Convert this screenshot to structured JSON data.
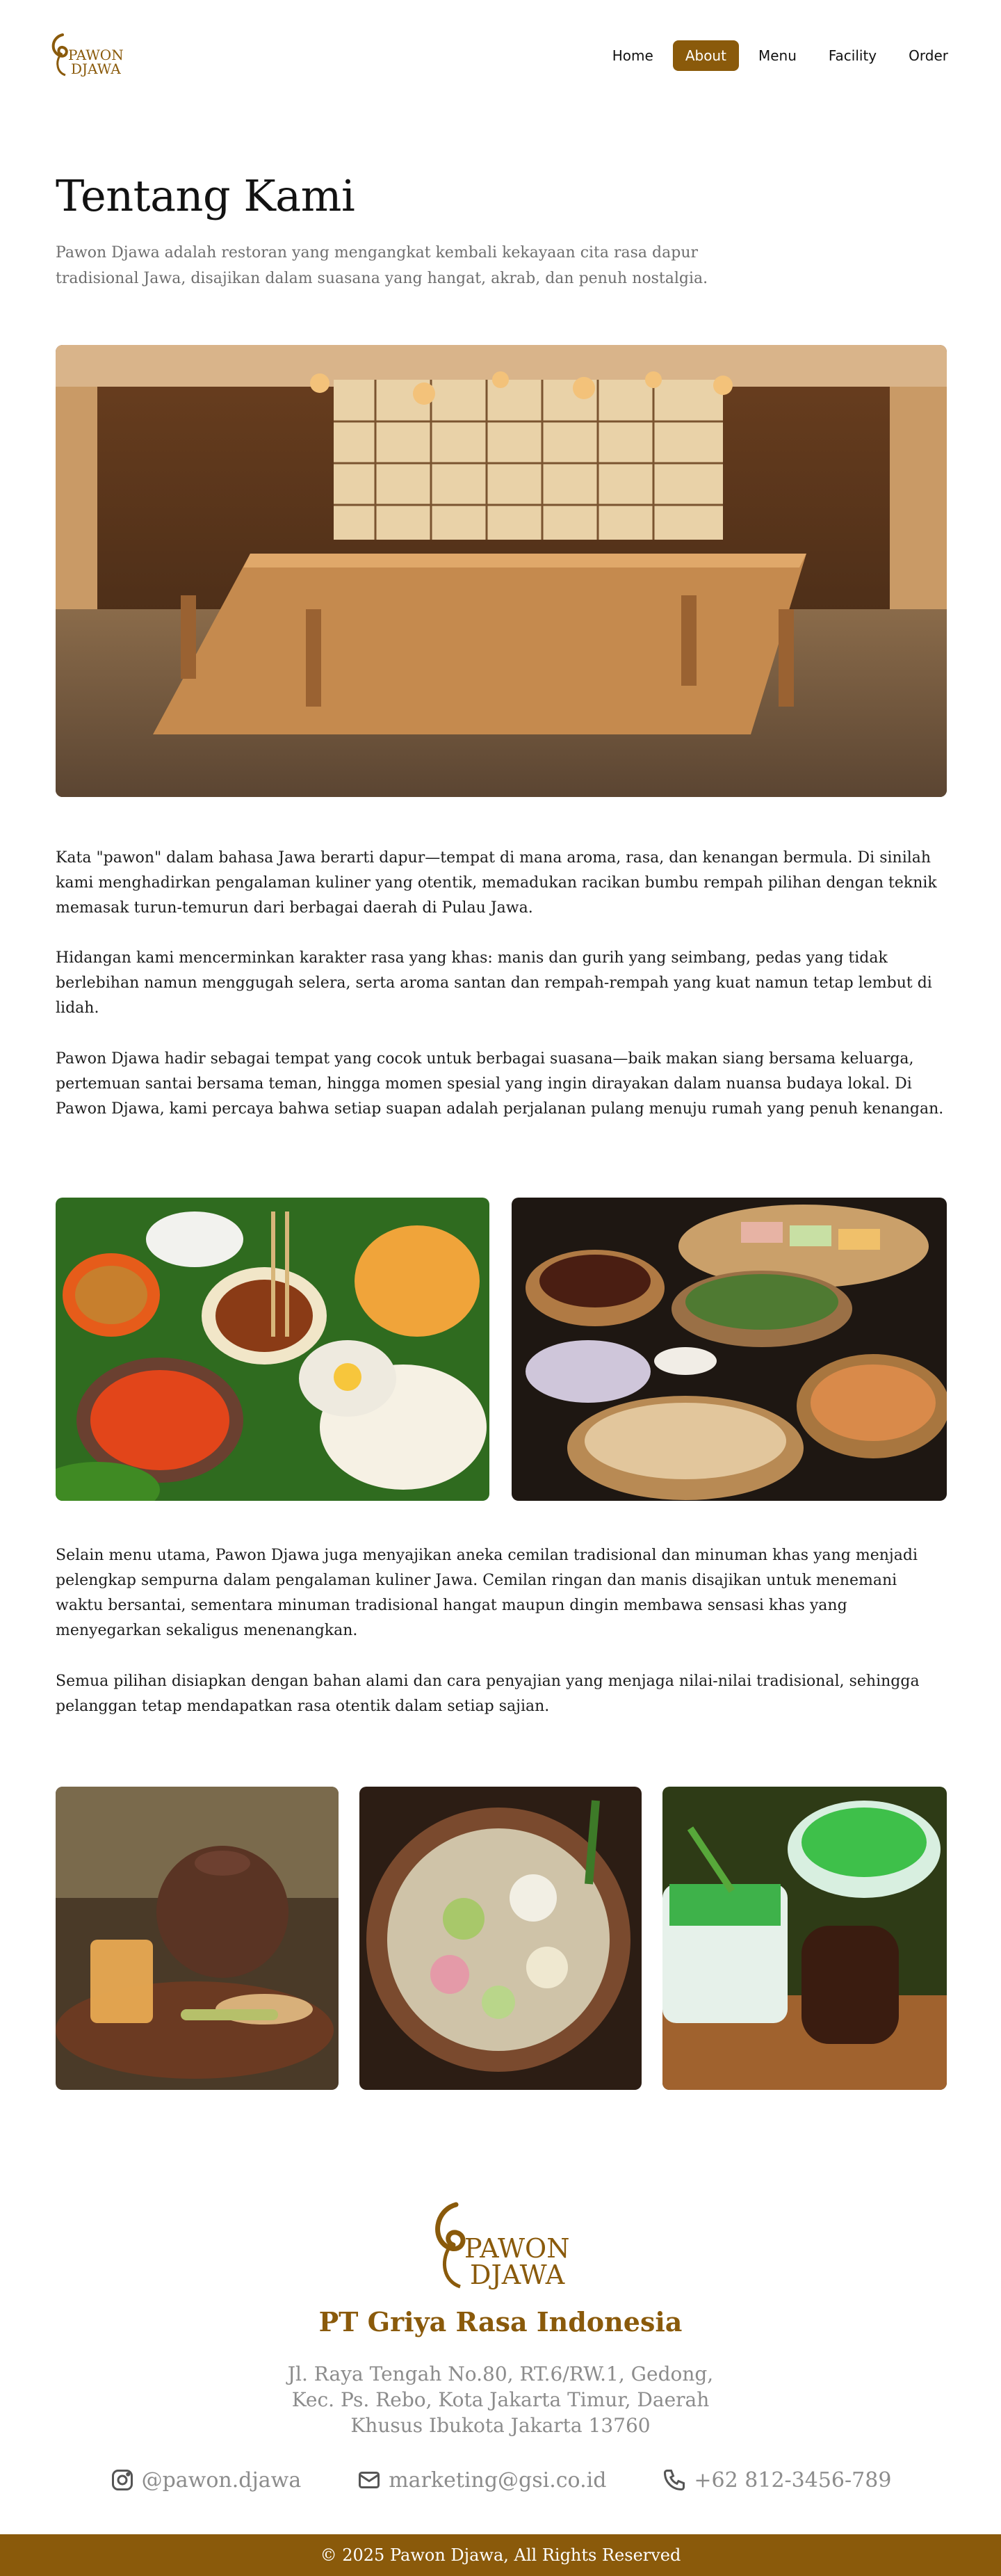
{
  "brand": {
    "logo_line1": "PAWON",
    "logo_line2": "DJAWA",
    "accent": "#8a5a0b"
  },
  "nav": {
    "items": [
      {
        "label": "Home",
        "active": false
      },
      {
        "label": "About",
        "active": true
      },
      {
        "label": "Menu",
        "active": false
      },
      {
        "label": "Facility",
        "active": false
      },
      {
        "label": "Order",
        "active": false
      }
    ]
  },
  "about": {
    "title": "Tentang Kami",
    "intro": "Pawon Djawa adalah restoran yang mengangkat kembali kekayaan cita rasa dapur tradisional Jawa, disajikan dalam suasana yang hangat, akrab, dan penuh nostalgia.",
    "paragraphs": [
      "Kata \"pawon\" dalam bahasa Jawa berarti dapur—tempat di mana aroma, rasa, dan kenangan bermula. Di sinilah kami menghadirkan pengalaman kuliner yang otentik, memadukan racikan bumbu rempah pilihan dengan teknik memasak turun-temurun dari berbagai daerah di Pulau Jawa.",
      "Hidangan kami mencerminkan karakter rasa yang khas: manis dan gurih yang seimbang, pedas yang tidak berlebihan namun menggugah selera, serta aroma santan dan rempah-rempah yang kuat namun tetap lembut di lidah.",
      "Pawon Djawa hadir sebagai tempat yang cocok untuk berbagai suasana—baik makan siang bersama keluarga, pertemuan santai bersama teman, hingga momen spesial yang ingin dirayakan dalam nuansa budaya lokal. Di Pawon Djawa, kami percaya bahwa setiap suapan adalah perjalanan pulang menuju rumah yang penuh kenangan."
    ],
    "snacks_paragraphs": [
      "Selain menu utama, Pawon Djawa juga menyajikan aneka cemilan tradisional dan minuman khas yang menjadi pelengkap sempurna dalam pengalaman kuliner Jawa. Cemilan ringan dan manis disajikan untuk menemani waktu bersantai, sementara minuman tradisional hangat maupun dingin membawa sensasi khas yang menyegarkan sekaligus menenangkan.",
      "Semua pilihan disiapkan dengan bahan alami dan cara penyajian yang menjaga nilai-nilai tradisional, sehingga pelanggan tetap mendapatkan rasa otentik dalam setiap sajian."
    ]
  },
  "footer": {
    "company": "PT Griya Rasa Indonesia",
    "address": "Jl. Raya Tengah No.80, RT.6/RW.1, Gedong, Kec. Ps. Rebo, Kota Jakarta Timur, Daerah Khusus Ibukota Jakarta 13760",
    "instagram": "@pawon.djawa",
    "email": "marketing@gsi.co.id",
    "phone": "+62 812-3456-789",
    "copyright": "© 2025 Pawon Djawa, All Rights Reserved"
  }
}
